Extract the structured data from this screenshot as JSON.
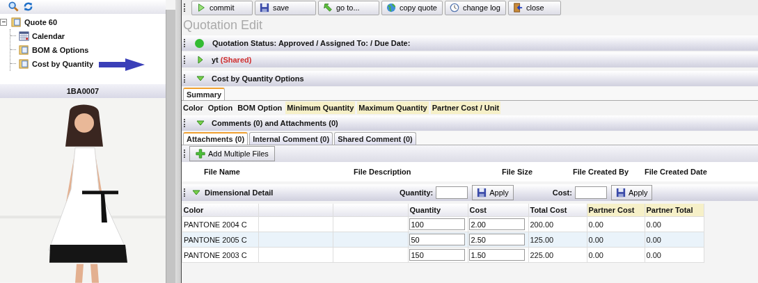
{
  "left_toolbar": {
    "buttons": [
      {
        "kind": "search"
      },
      {
        "kind": "refresh"
      }
    ]
  },
  "tree": {
    "label": "Quote 60",
    "expanded": true,
    "children": [
      {
        "label": "Calendar",
        "kind": "calendar"
      },
      {
        "label": "BOM & Options",
        "kind": "folder"
      },
      {
        "label": "Cost by Quantity",
        "kind": "folder"
      }
    ]
  },
  "item_header": "1BA0007",
  "toolbar": {
    "buttons": [
      {
        "label": "commit",
        "kind": "play"
      },
      {
        "label": "save",
        "kind": "save"
      },
      {
        "label": "go to...",
        "kind": "goto"
      },
      {
        "label": "copy quote",
        "kind": "globe"
      },
      {
        "label": "change log",
        "kind": "clock"
      },
      {
        "label": "close",
        "kind": "door"
      }
    ]
  },
  "page_title": "Quotation Edit",
  "status_bar": {
    "text": "Quotation Status: Approved / Assigned To: / Due Date:",
    "color": "#33bb33"
  },
  "shared_section": {
    "title": "yt",
    "tag": "(Shared)",
    "expanded": false
  },
  "cost_section": {
    "title": "Cost by Quantity Options",
    "expanded": true,
    "tabs": [
      {
        "label": "Summary",
        "selected": true
      }
    ],
    "columns": [
      {
        "label": "Color",
        "highlight": false
      },
      {
        "label": "Option",
        "highlight": false
      },
      {
        "label": "BOM Option",
        "highlight": false
      },
      {
        "label": "Minimum Quantity",
        "highlight": true
      },
      {
        "label": "Maximum Quantity",
        "highlight": true
      },
      {
        "label": "Partner Cost / Unit",
        "highlight": true
      }
    ]
  },
  "comments_section": {
    "title": "Comments (0) and Attachments (0)",
    "expanded": true,
    "tabs": [
      {
        "label": "Attachments (0)",
        "selected": true
      },
      {
        "label": "Internal Comment (0)",
        "selected": false
      },
      {
        "label": "Shared Comment (0)",
        "selected": false
      }
    ],
    "add_button": "Add Multiple Files",
    "columns": [
      "File Name",
      "File Description",
      "File Size",
      "File Created By",
      "File Created Date"
    ]
  },
  "dimensional_section": {
    "title": "Dimensional Detail",
    "expanded": true,
    "quantity_label": "Quantity:",
    "cost_label": "Cost:",
    "apply_buttons": [
      "Apply",
      "Apply"
    ],
    "table": {
      "columns": [
        {
          "kind": "text",
          "label": "Color",
          "highlight": false
        },
        {
          "kind": "blank"
        },
        {
          "kind": "blank"
        },
        {
          "kind": "text",
          "label": "Quantity",
          "highlight": false
        },
        {
          "kind": "text",
          "label": "Cost",
          "highlight": false
        },
        {
          "kind": "text",
          "label": "Total Cost",
          "highlight": false
        },
        {
          "kind": "text",
          "label": "Partner Cost",
          "highlight": true
        },
        {
          "kind": "text",
          "label": "Partner Total",
          "highlight": true
        }
      ],
      "rows": [
        {
          "color_name": "PANTONE 2004 C",
          "quantity": "100",
          "cost": "2.00",
          "total_cost": "200.00",
          "partner_cost": "0.00",
          "partner_total": "0.00",
          "selected": false
        },
        {
          "color_name": "PANTONE 2005 C",
          "quantity": "50",
          "cost": "2.50",
          "total_cost": "125.00",
          "partner_cost": "0.00",
          "partner_total": "0.00",
          "selected": true
        },
        {
          "color_name": "PANTONE 2003 C",
          "quantity": "150",
          "cost": "1.50",
          "total_cost": "225.00",
          "partner_cost": "0.00",
          "partner_total": "0.00",
          "selected": false
        }
      ]
    }
  }
}
